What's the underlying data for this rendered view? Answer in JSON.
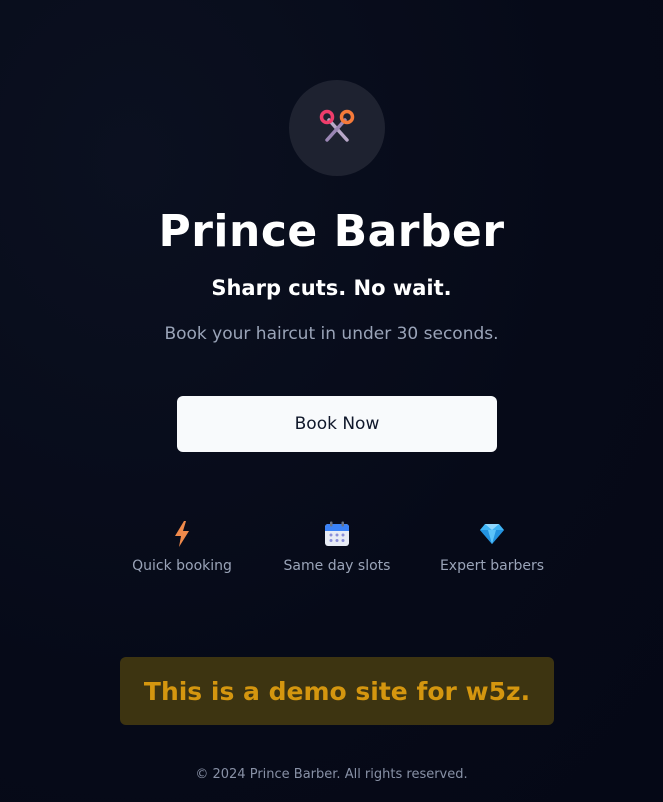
{
  "brand": {
    "logo_icon": "scissors-icon",
    "name": "Prince Barber",
    "tagline": "Sharp cuts. No wait.",
    "subtitle": "Book your haircut in under 30 seconds."
  },
  "cta": {
    "label": "Book Now"
  },
  "features": [
    {
      "icon": "lightning-icon",
      "label": "Quick booking"
    },
    {
      "icon": "calendar-icon",
      "label": "Same day slots"
    },
    {
      "icon": "diamond-icon",
      "label": "Expert barbers"
    }
  ],
  "demo_banner": {
    "text": "This is a demo site for w5z."
  },
  "footer": {
    "copyright": "© 2024 Prince Barber. All rights reserved."
  },
  "colors": {
    "background": "#050816",
    "logo_circle": "#1e2230",
    "button_bg": "#f8fafc",
    "button_text": "#0f172a",
    "muted_text": "#9aa4b8",
    "banner_bg": "#3d3411",
    "banner_text": "#d4960f"
  }
}
